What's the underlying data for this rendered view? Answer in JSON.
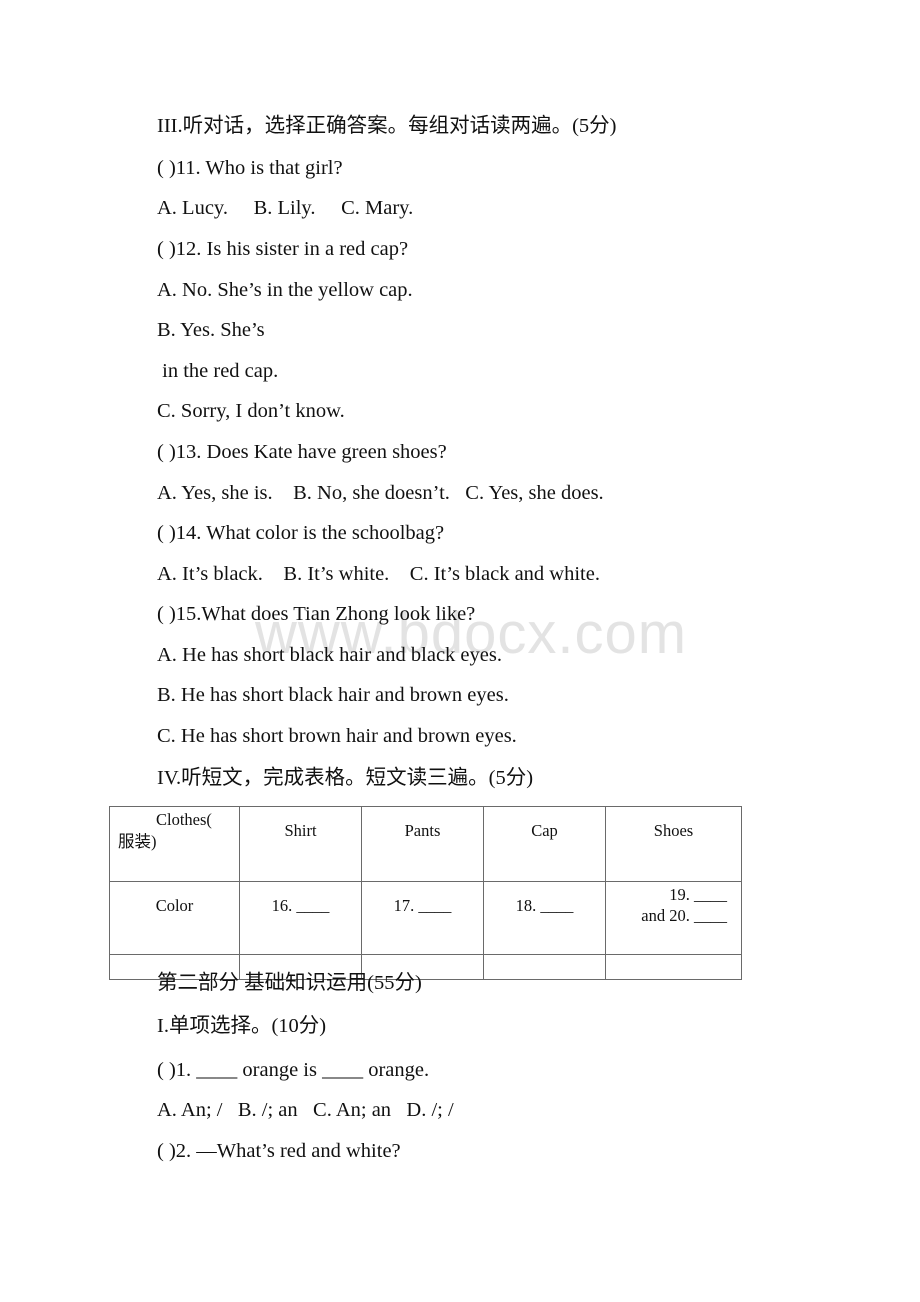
{
  "watermark": "www.bdocx.com",
  "section3": {
    "heading": "III.听对话，选择正确答案。每组对话读两遍。(5分)",
    "questions": [
      {
        "stem": "( )11. Who is that girl?",
        "options": [
          "A. Lucy.     B. Lily.     C. Mary."
        ]
      },
      {
        "stem": "( )12. Is his sister in a red cap?",
        "options": [
          "A. No. She’s in the yellow cap.",
          "B. Yes. She’s",
          " in the red cap.",
          "C. Sorry, I don’t know."
        ]
      },
      {
        "stem": "( )13. Does Kate have green shoes?",
        "options": [
          "A. Yes, she is.    B. No, she doesn’t.   C. Yes, she does."
        ]
      },
      {
        "stem": "( )14. What color is the schoolbag?",
        "options": [
          "A. It’s black.    B. It’s white.    C. It’s black and white."
        ]
      },
      {
        "stem": "( )15.What does Tian Zhong look like?",
        "options": [
          "A. He has short black hair and black eyes.",
          "B. He has short black hair and brown eyes.",
          "C. He has short brown hair and brown eyes."
        ]
      }
    ]
  },
  "section4": {
    "heading": "IV.听短文，完成表格。短文读三遍。(5分)",
    "table": {
      "header": {
        "first_line1": "Clothes(",
        "first_line2": "服装)",
        "cols": [
          "Shirt",
          "Pants",
          "Cap",
          "Shoes"
        ]
      },
      "row": {
        "label": "Color",
        "cells": [
          "16. ____",
          "17. ____",
          "18. ____"
        ],
        "last_line1": "19. ____",
        "last_line2": "and 20. ____"
      }
    }
  },
  "part2": {
    "heading": "第二部分 基础知识运用(55分)",
    "section1_heading": "I.单项选择。(10分)",
    "q1_stem": "( )1. ____ orange is ____ orange.",
    "q1_options": "A. An; /   B. /; an   C. An; an   D. /; /",
    "q2_stem": "( )2. —What’s red and white?"
  }
}
